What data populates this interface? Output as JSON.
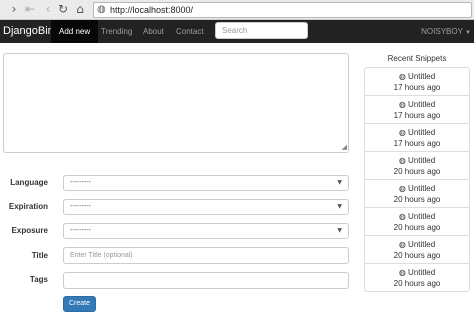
{
  "browser": {
    "back_icon": "chevron-right-icon",
    "url": "http://localhost:8000/"
  },
  "navbar": {
    "brand": "DjangoBin",
    "items": [
      {
        "label": "Add new",
        "active": true
      },
      {
        "label": "Trending",
        "active": false
      },
      {
        "label": "About",
        "active": false
      },
      {
        "label": "Contact",
        "active": false
      }
    ],
    "search_placeholder": "Search",
    "user": "NOISYBOY",
    "bg_color": "#222222"
  },
  "form": {
    "fields": [
      {
        "label": "Language",
        "value": "---------"
      },
      {
        "label": "Expiration",
        "value": "---------"
      },
      {
        "label": "Exposure",
        "value": "---------"
      }
    ],
    "title_label": "Title",
    "title_placeholder": "Enter Title (optional)",
    "tags_label": "Tags",
    "tags_value": "",
    "submit_label": "Create",
    "submit_color": "#337ab7"
  },
  "sidebar": {
    "heading": "Recent Snippets",
    "snippets": [
      {
        "title": "Untitled",
        "time": "17 hours ago"
      },
      {
        "title": "Untitled",
        "time": "17 hours ago"
      },
      {
        "title": "Untitled",
        "time": "17 hours ago"
      },
      {
        "title": "Untitled",
        "time": "20 hours ago"
      },
      {
        "title": "Untitled",
        "time": "20 hours ago"
      },
      {
        "title": "Untitled",
        "time": "20 hours ago"
      },
      {
        "title": "Untitled",
        "time": "20 hours ago"
      },
      {
        "title": "Untitled",
        "time": "20 hours ago"
      }
    ]
  }
}
